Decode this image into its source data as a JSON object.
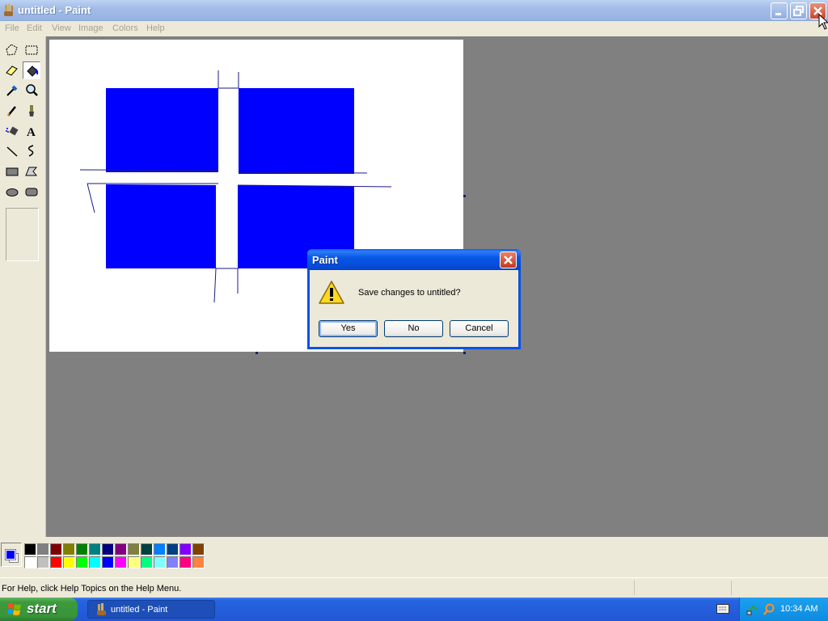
{
  "window": {
    "title": "untitled - Paint",
    "buttons": [
      "minimize",
      "restore",
      "close"
    ]
  },
  "menu": [
    "File",
    "Edit",
    "View",
    "Image",
    "Colors",
    "Help"
  ],
  "toolbox": {
    "tools": [
      "free-form-select",
      "select",
      "eraser",
      "fill-with-color",
      "pick-color",
      "magnifier",
      "pencil",
      "brush",
      "airbrush",
      "text",
      "line",
      "curve",
      "rectangle",
      "polygon",
      "ellipse",
      "rounded-rectangle"
    ],
    "active": "fill-with-color"
  },
  "colors": {
    "foreground": "#0000FF",
    "background": "#FFFFFF",
    "palette_top": [
      "#000000",
      "#808080",
      "#800000",
      "#808000",
      "#008000",
      "#008080",
      "#000080",
      "#800080",
      "#808040",
      "#004040",
      "#0080FF",
      "#004080",
      "#8000FF",
      "#804000"
    ],
    "palette_bottom": [
      "#FFFFFF",
      "#C0C0C0",
      "#FF0000",
      "#FFFF00",
      "#00FF00",
      "#00FFFF",
      "#0000FF",
      "#FF00FF",
      "#FFFF80",
      "#00FF80",
      "#80FFFF",
      "#8080FF",
      "#FF0080",
      "#FF8040"
    ]
  },
  "status": {
    "help_text": "For Help, click Help Topics on the Help Menu."
  },
  "dialog": {
    "title": "Paint",
    "message": "Save changes to untitled?",
    "icon": "warning-icon",
    "buttons": {
      "yes": "Yes",
      "no": "No",
      "cancel": "Cancel"
    },
    "default": "yes"
  },
  "taskbar": {
    "start_label": "start",
    "task_label": "untitled - Paint",
    "clock": "10:34 AM"
  }
}
